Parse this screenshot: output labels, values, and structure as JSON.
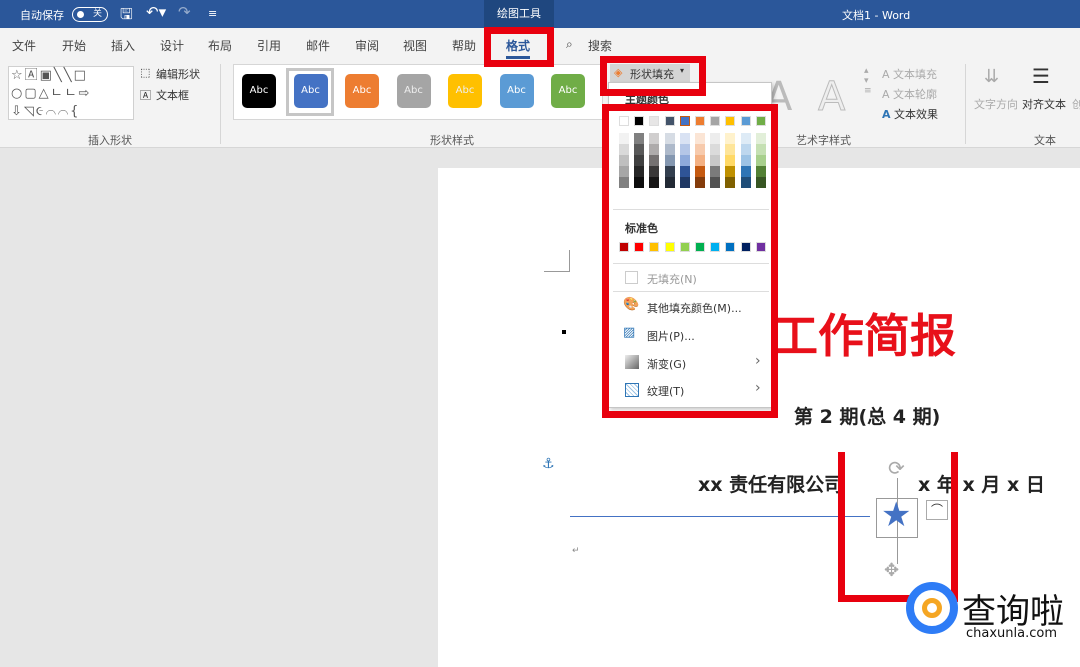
{
  "titlebar": {
    "autosave": "自动保存",
    "toggle": "关",
    "drawing_tools": "绘图工具",
    "title": "文档1 - Word"
  },
  "tabs": [
    "文件",
    "开始",
    "插入",
    "设计",
    "布局",
    "引用",
    "邮件",
    "审阅",
    "视图",
    "帮助",
    "格式"
  ],
  "search": "搜索",
  "ribbon": {
    "insert_shapes": {
      "label": "插入形状",
      "shapes_row1": "☆🄰▣╲╲□",
      "shapes_row2": "○▢△ㄴㄴ⇨",
      "shapes_row3": "⇩◹૯⌒⌒{",
      "edit_shape": "编辑形状",
      "textbox": "文本框"
    },
    "shape_styles": {
      "label": "形状样式",
      "preset_text": "Abc",
      "presets": [
        "#000000",
        "#4472c4",
        "#ed7d31",
        "#a5a5a5",
        "#ffc000",
        "#5b9bd5",
        "#70ad47"
      ],
      "shape_fill": "形状填充"
    },
    "wordart": {
      "label": "艺术字样式",
      "letter": "A",
      "text_fill": "文本填充",
      "text_outline": "文本轮廓",
      "text_effects": "文本效果"
    },
    "text": {
      "label": "文本",
      "direction": "文字方向",
      "align": "对齐文本",
      "create_link": "创"
    }
  },
  "fill_menu": {
    "theme_label": "主题颜色",
    "theme_colors": [
      "#ffffff",
      "#000000",
      "#e7e6e6",
      "#44546a",
      "#4472c4",
      "#ed7d31",
      "#a5a5a5",
      "#ffc000",
      "#5b9bd5",
      "#70ad47"
    ],
    "shades": [
      [
        "#f2f2f2",
        "#d9d9d9",
        "#bfbfbf",
        "#a6a6a6",
        "#808080"
      ],
      [
        "#808080",
        "#595959",
        "#404040",
        "#262626",
        "#0d0d0d"
      ],
      [
        "#d0cece",
        "#aeabab",
        "#757171",
        "#3a3838",
        "#171616"
      ],
      [
        "#d6dce4",
        "#adb9ca",
        "#8497b0",
        "#333f4f",
        "#222a35"
      ],
      [
        "#d9e2f3",
        "#b4c6e7",
        "#8eaadb",
        "#2f5496",
        "#1f3864"
      ],
      [
        "#fbe5d5",
        "#f7caac",
        "#f4b183",
        "#c55a11",
        "#843c0b"
      ],
      [
        "#ededed",
        "#dbdbdb",
        "#c9c9c9",
        "#7b7b7b",
        "#525252"
      ],
      [
        "#fff2cc",
        "#fee599",
        "#ffd966",
        "#bf9000",
        "#7f6000"
      ],
      [
        "#deebf6",
        "#bdd7ee",
        "#9cc3e5",
        "#2e75b5",
        "#1f4e79"
      ],
      [
        "#e2efd9",
        "#c5e0b3",
        "#a8d08d",
        "#538135",
        "#375623"
      ]
    ],
    "standard_label": "标准色",
    "standard_colors": [
      "#c00000",
      "#ff0000",
      "#ffc000",
      "#ffff00",
      "#92d050",
      "#00b050",
      "#00b0f0",
      "#0070c0",
      "#002060",
      "#7030a0"
    ],
    "no_fill": "无填充(N)",
    "more_colors": "其他填充颜色(M)...",
    "picture": "图片(P)...",
    "gradient": "渐变(G)",
    "texture": "纹理(T)"
  },
  "document": {
    "title": "工作简报",
    "issue": "第 2 期(总 4 期)",
    "company": "xx 责任有限公司",
    "date": "x 年 x 月 x 日"
  },
  "watermark": {
    "brand": "查询啦",
    "url": "chaxunla.com"
  }
}
